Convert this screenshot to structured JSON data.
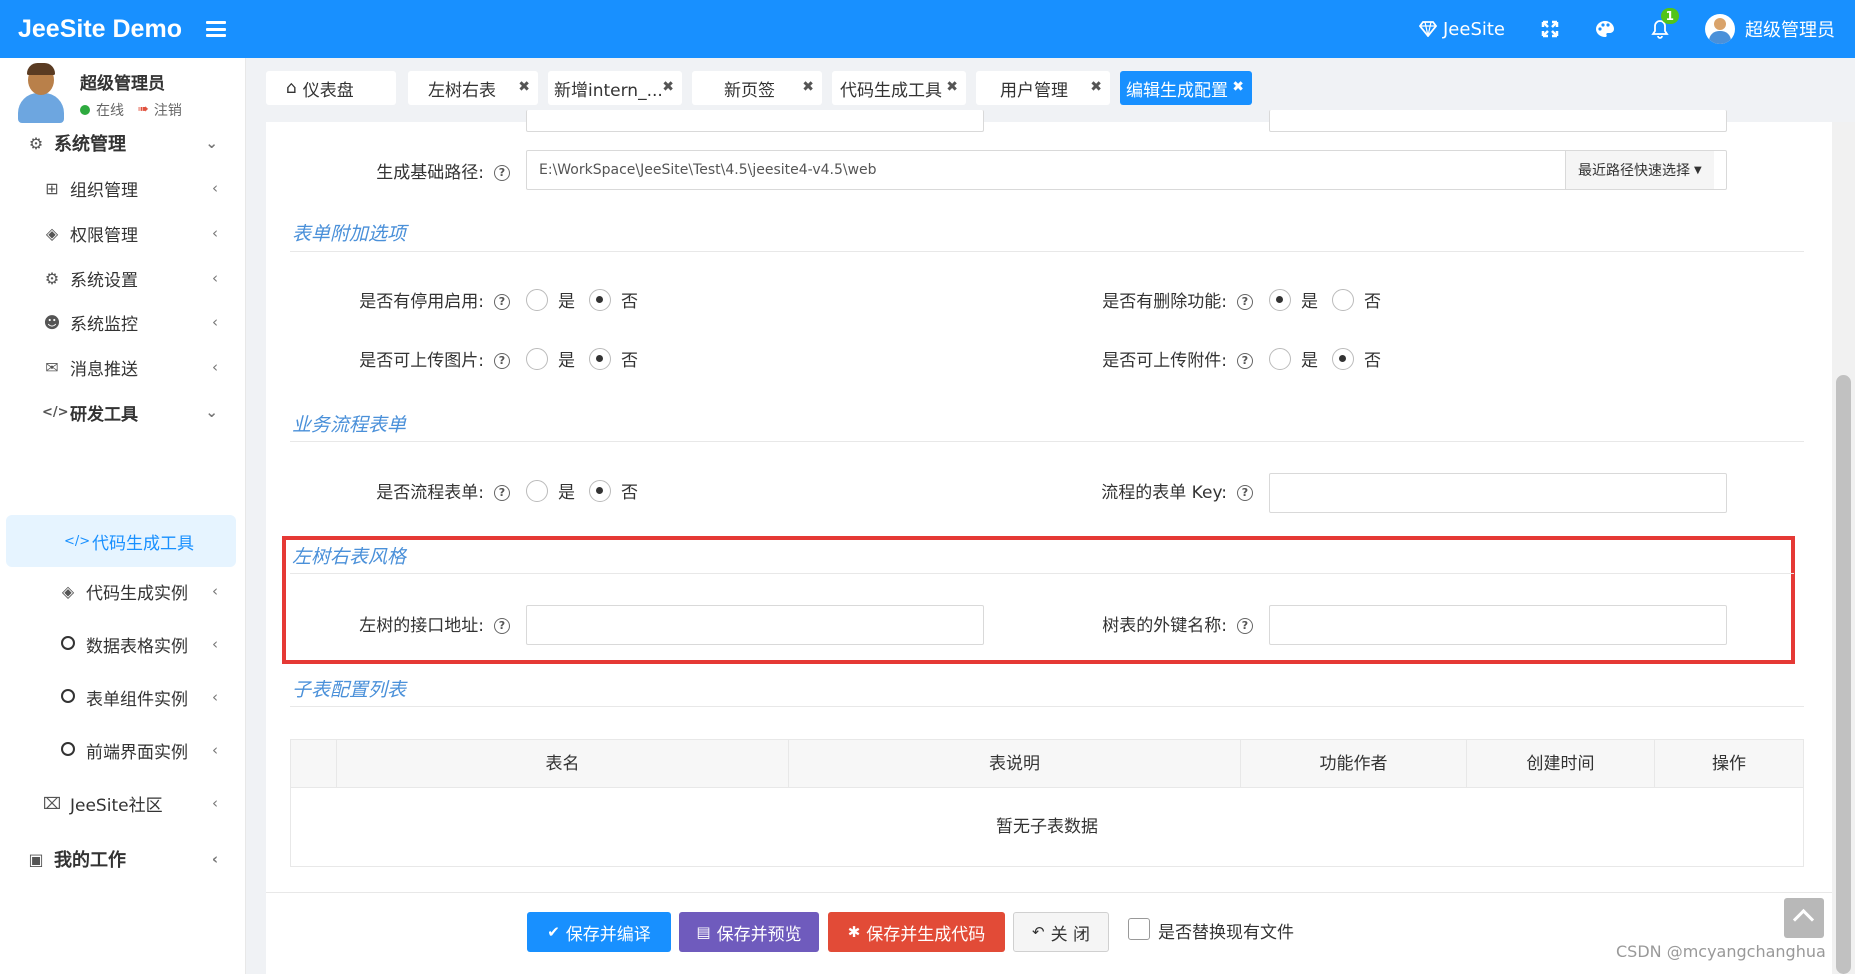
{
  "header": {
    "brand": "JeeSite Demo",
    "jeesite_link": "JeeSite",
    "notification_count": "1",
    "user_name": "超级管理员"
  },
  "sidebar": {
    "user": {
      "name": "超级管理员",
      "status": "在线",
      "logout": "注销"
    },
    "items": [
      {
        "label": "系统管理",
        "icon": "gear-icon"
      },
      {
        "label": "组织管理",
        "icon": "grid-icon"
      },
      {
        "label": "权限管理",
        "icon": "layers-icon"
      },
      {
        "label": "系统设置",
        "icon": "gear-icon"
      },
      {
        "label": "系统监控",
        "icon": "ghost-icon"
      },
      {
        "label": "消息推送",
        "icon": "inbox-icon"
      },
      {
        "label": "研发工具",
        "icon": "code-icon"
      },
      {
        "label": "代码生成工具",
        "icon": "code-icon"
      },
      {
        "label": "代码生成实例",
        "icon": "layers-icon"
      },
      {
        "label": "数据表格实例",
        "icon": "circle-icon"
      },
      {
        "label": "表单组件实例",
        "icon": "circle-icon"
      },
      {
        "label": "前端界面实例",
        "icon": "circle-icon"
      },
      {
        "label": "JeeSite社区",
        "icon": "signpost-icon"
      },
      {
        "label": "我的工作",
        "icon": "desktop-icon"
      }
    ]
  },
  "tabs": [
    {
      "label": "仪表盘"
    },
    {
      "label": "左树右表"
    },
    {
      "label": "新增intern_..."
    },
    {
      "label": "新页签"
    },
    {
      "label": "代码生成工具"
    },
    {
      "label": "用户管理"
    },
    {
      "label": "编辑生成配置"
    }
  ],
  "form": {
    "base_path_label": "生成基础路径:",
    "base_path_value": "E:\\WorkSpace\\JeeSite\\Test\\4.5\\jeesite4-v4.5\\web",
    "quick_select": "最近路径快速选择",
    "section_form_options": "表单附加选项",
    "disable_label": "是否有停用启用:",
    "delete_label": "是否有删除功能:",
    "upload_image_label": "是否可上传图片:",
    "upload_file_label": "是否可上传附件:",
    "yes": "是",
    "no": "否",
    "section_flow": "业务流程表单",
    "flow_label": "是否流程表单:",
    "flow_key_label": "流程的表单 Key:",
    "section_tree": "左树右表风格",
    "tree_api_label": "左树的接口地址:",
    "tree_fk_label": "树表的外键名称:",
    "section_child": "子表配置列表"
  },
  "child_table": {
    "columns": [
      "表名",
      "表说明",
      "功能作者",
      "创建时间",
      "操作"
    ],
    "empty_text": "暂无子表数据"
  },
  "footer": {
    "save_compile": "保存并编译",
    "save_preview": "保存并预览",
    "save_generate": "保存并生成代码",
    "close": "关 闭",
    "replace_label": "是否替换现有文件"
  },
  "watermark": "CSDN @mcyangchanghua",
  "colors": {
    "primary": "#1890ff",
    "danger": "#e24b37",
    "purple": "#6f5bbd",
    "highlight_box": "#e53935"
  }
}
